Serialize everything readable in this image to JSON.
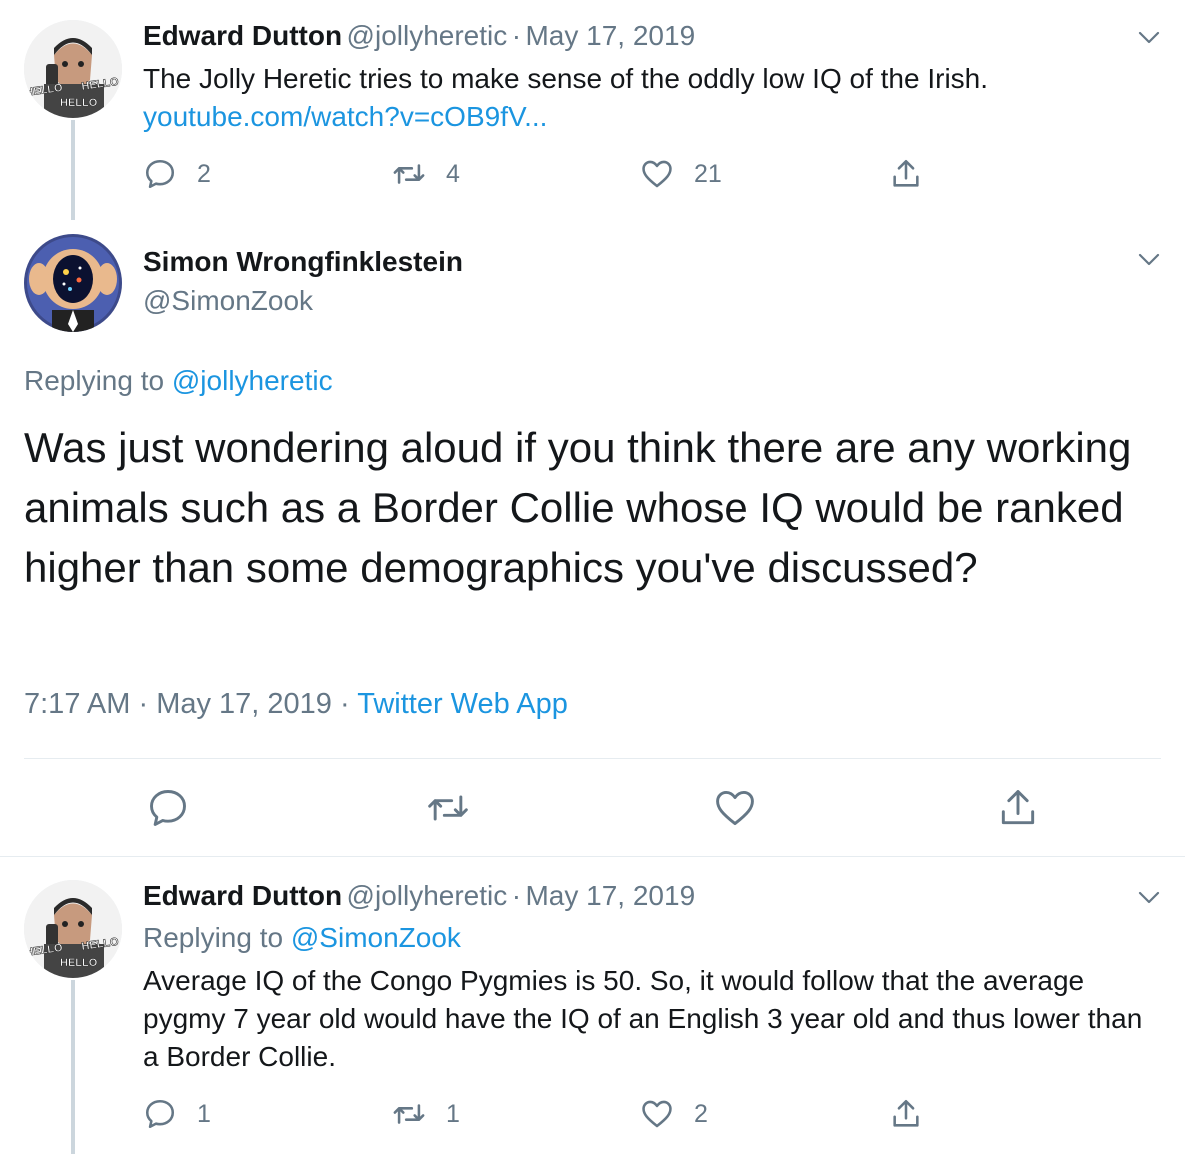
{
  "tweet1": {
    "name": "Edward Dutton",
    "handle": "@jollyheretic",
    "sep": "·",
    "date": "May 17, 2019",
    "text": "The Jolly Heretic tries to make sense of the oddly low IQ of the Irish.",
    "link": "youtube.com/watch?v=cOB9fV...",
    "avatar_words": [
      "HELLO",
      "HELLO",
      "HELLO"
    ],
    "replies": "2",
    "retweets": "4",
    "likes": "21"
  },
  "tweet2": {
    "name": "Simon Wrongfinklestein",
    "handle": "@SimonZook",
    "replying_label": "Replying to",
    "replying_handle": "@jollyheretic",
    "text": "Was just wondering aloud if you think there are any working animals such as a Border Collie whose IQ would be ranked higher than some demographics you've discussed?",
    "time": "7:17 AM",
    "sep1": "·",
    "date": "May 17, 2019",
    "sep2": "·",
    "source": "Twitter Web App"
  },
  "tweet3": {
    "name": "Edward Dutton",
    "handle": "@jollyheretic",
    "sep": "·",
    "date": "May 17, 2019",
    "replying_label": "Replying to",
    "replying_handle": "@SimonZook",
    "text": "Average IQ of the Congo Pygmies is 50. So, it would follow that the average pygmy 7 year old would have the IQ of an English 3 year old and thus lower than a Border Collie.",
    "avatar_words": [
      "HELLO",
      "HELLO",
      "HELLO"
    ],
    "replies": "1",
    "retweets": "1",
    "likes": "2"
  },
  "icons": {
    "reply": "reply-icon",
    "retweet": "retweet-icon",
    "like": "heart-icon",
    "share": "share-icon",
    "more": "chevron-down-icon"
  },
  "colors": {
    "link": "#1b95e0",
    "secondary": "#657786",
    "text": "#14171a",
    "thread": "#ccd6dd"
  }
}
